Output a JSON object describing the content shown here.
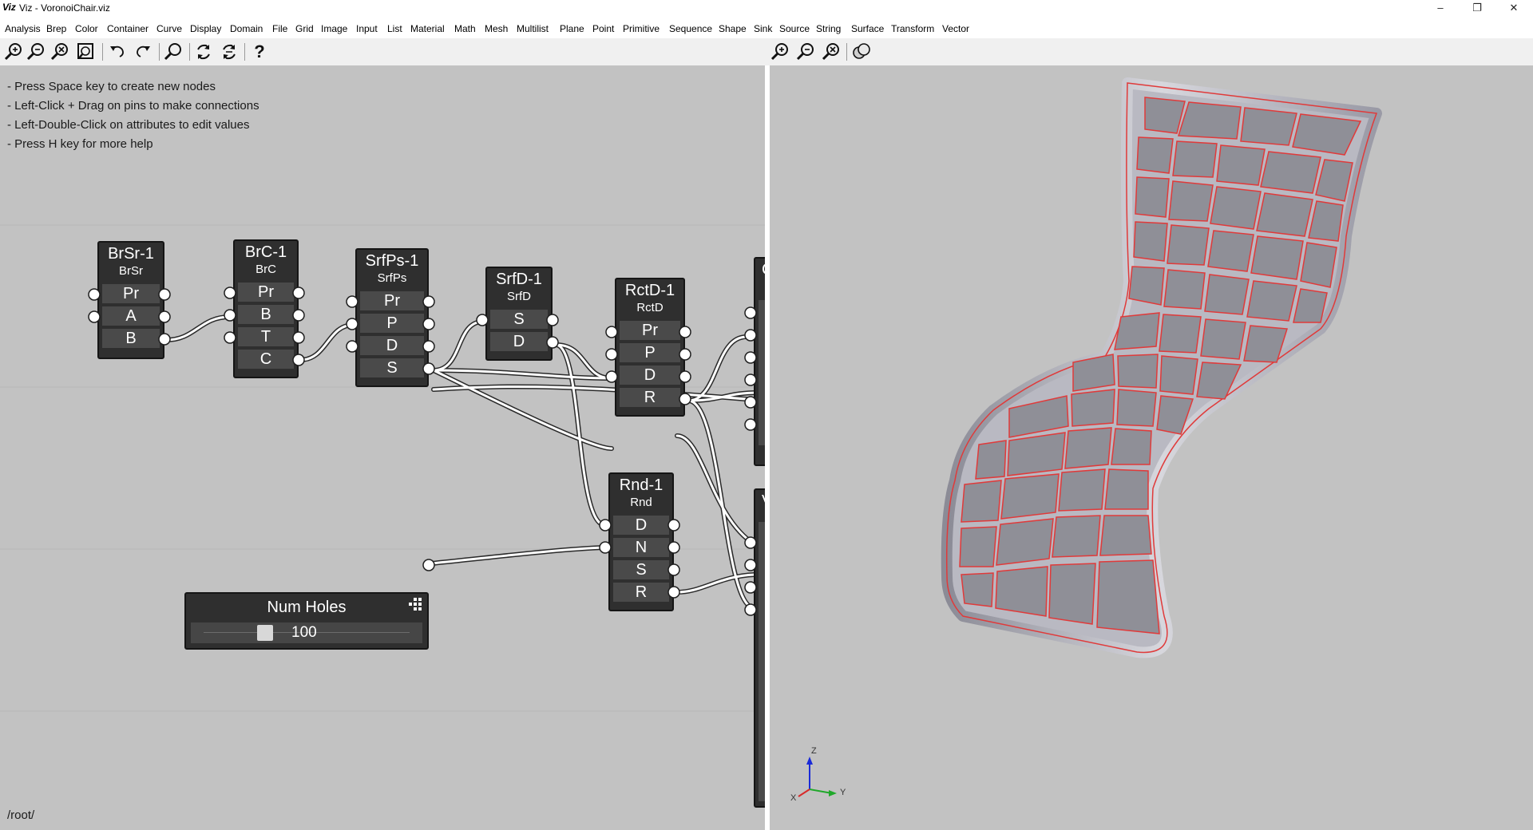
{
  "window": {
    "app_logo": "Viz",
    "title": "Viz - VoronoiChair.viz"
  },
  "menu": {
    "items": [
      "Analysis",
      "Brep",
      "Color",
      "Container",
      "Curve",
      "Display",
      "Domain",
      "File",
      "Grid",
      "Image",
      "Input",
      "List",
      "Material",
      "Math",
      "Mesh",
      "Multilist",
      "Plane",
      "Point",
      "Primitive",
      "Sequence",
      "Shape",
      "Sink",
      "Source",
      "String",
      "Surface",
      "Transform",
      "Vector"
    ]
  },
  "toolbar": {
    "editor_tools": [
      "zoom-in-icon",
      "zoom-out-icon",
      "zoom-reset-icon",
      "zoom-fit-icon",
      "undo-icon",
      "redo-icon",
      "search-icon",
      "refresh-icon",
      "refresh-all-icon",
      "help-icon"
    ],
    "viewport_tools": [
      "zoom-in-icon",
      "zoom-out-icon",
      "zoom-reset-icon",
      "shading-icon"
    ],
    "help_glyph": "?"
  },
  "editor": {
    "hints": [
      "- Press Space key to create new nodes",
      "- Left-Click + Drag on pins to make connections",
      "- Left-Double-Click on attributes to edit values",
      "- Press H key for more help"
    ],
    "path": "/root/",
    "nodes": [
      {
        "title": "BrSr-1",
        "subtitle": "BrSr",
        "attrs": [
          "Pr",
          "A",
          "B"
        ]
      },
      {
        "title": "BrC-1",
        "subtitle": "BrC",
        "attrs": [
          "Pr",
          "B",
          "T",
          "C"
        ]
      },
      {
        "title": "SrfPs-1",
        "subtitle": "SrfPs",
        "attrs": [
          "Pr",
          "P",
          "D",
          "S"
        ]
      },
      {
        "title": "SrfD-1",
        "subtitle": "SrfD",
        "attrs": [
          "S",
          "D"
        ]
      },
      {
        "title": "RctD-1",
        "subtitle": "RctD",
        "attrs": [
          "Pr",
          "P",
          "D",
          "R"
        ]
      },
      {
        "title": "Rnd-1",
        "subtitle": "Rnd",
        "attrs": [
          "D",
          "N",
          "S",
          "R"
        ]
      }
    ],
    "num_holes": {
      "label": "Num Holes",
      "value": "100",
      "fraction": 0.28
    },
    "offscreen_node_title_fragment": "C",
    "offscreen_node2_title_fragment": "V"
  },
  "viewport": {
    "axes": {
      "z": "Z",
      "y": "Y",
      "x": "X"
    }
  },
  "colors": {
    "node_bg": "#2f2f2f",
    "attr_bg": "#4a4a4a",
    "wire": "#ffffff",
    "edge_red": "#e03a3a",
    "canvas": "#c2c2c2"
  }
}
